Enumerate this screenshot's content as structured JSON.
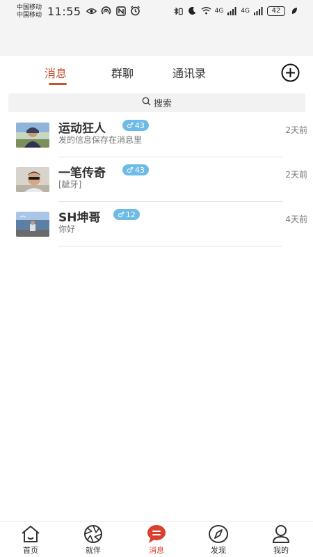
{
  "status": {
    "carrier1": "中国移动",
    "carrier2": "中国移动",
    "time": "11:55",
    "battery": "42",
    "signal_label1": "4G",
    "signal_label2": "4G"
  },
  "tabs": [
    {
      "label": "消息",
      "active": true
    },
    {
      "label": "群聊",
      "active": false
    },
    {
      "label": "通讯录",
      "active": false
    }
  ],
  "search": {
    "placeholder": "搜索"
  },
  "conversations": [
    {
      "name": "运动狂人",
      "gender": "♂",
      "age": "43",
      "message": "发的信息保存在消息里",
      "time": "2天前"
    },
    {
      "name": "一笔传奇",
      "gender": "♂",
      "age": "43",
      "message": "[龇牙]",
      "time": "2天前"
    },
    {
      "name": "SH坤哥",
      "gender": "♂",
      "age": "12",
      "message": "你好",
      "time": "4天前"
    }
  ],
  "bottom_nav": [
    {
      "label": "首页",
      "icon": "home-icon",
      "active": false
    },
    {
      "label": "就伴",
      "icon": "aperture-icon",
      "active": false
    },
    {
      "label": "消息",
      "icon": "chat-icon",
      "active": true
    },
    {
      "label": "发现",
      "icon": "compass-icon",
      "active": false
    },
    {
      "label": "我的",
      "icon": "person-icon",
      "active": false
    }
  ],
  "colors": {
    "accent": "#c9512e",
    "badge": "#6dbbe6",
    "nav_active": "#d9412e"
  }
}
